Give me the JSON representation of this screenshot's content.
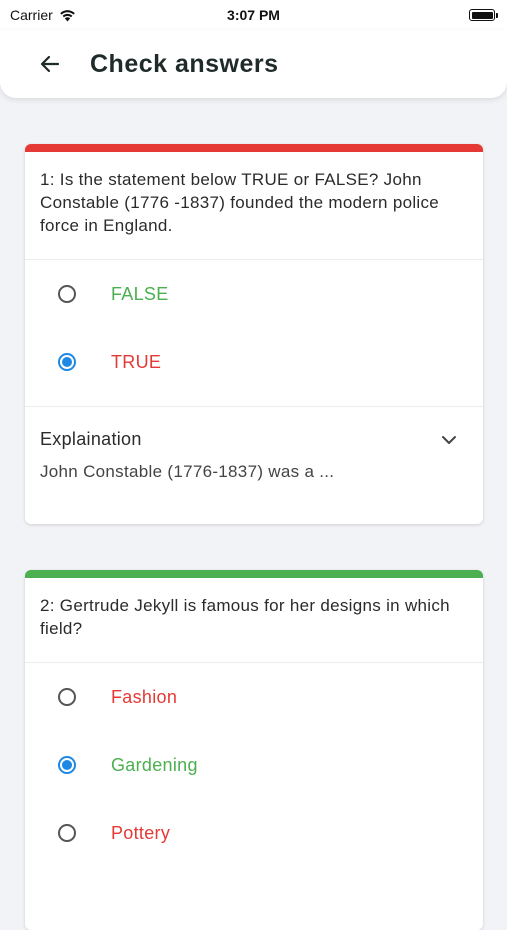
{
  "status": {
    "carrier": "Carrier",
    "time": "3:07 PM"
  },
  "header": {
    "title": "Check answers"
  },
  "colors": {
    "correct": "#4caf50",
    "wrong": "#e53935",
    "selected_radio": "#1e88e5"
  },
  "questions": [
    {
      "accent_color": "#e53935",
      "text": "1: Is the statement below TRUE or FALSE? John Constable (1776 -1837) founded the modern police force in England.",
      "options": [
        {
          "label": "FALSE",
          "status": "correct",
          "selected": false
        },
        {
          "label": "TRUE",
          "status": "wrong",
          "selected": true
        }
      ],
      "explanation": {
        "title": "Explaination",
        "preview": "John Constable (1776-1837) was a ..."
      }
    },
    {
      "accent_color": "#4caf50",
      "text": "2: Gertrude Jekyll is famous for her designs in which field?",
      "options": [
        {
          "label": "Fashion",
          "status": "wrong",
          "selected": false
        },
        {
          "label": "Gardening",
          "status": "correct",
          "selected": true
        },
        {
          "label": "Pottery",
          "status": "wrong",
          "selected": false
        }
      ]
    }
  ]
}
